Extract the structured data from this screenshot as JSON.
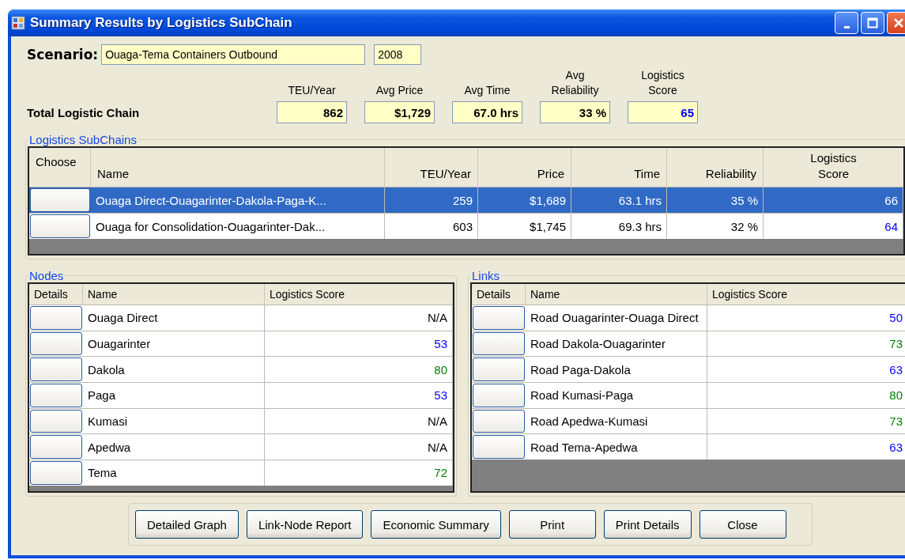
{
  "window": {
    "title": "Summary Results by Logistics SubChain"
  },
  "scenario": {
    "label": "Scenario:",
    "name": "Ouaga-Tema Containers Outbound",
    "year": "2008"
  },
  "totals": {
    "label": "Total Logistic Chain",
    "columns": [
      {
        "heading": "TEU/Year",
        "value": "862"
      },
      {
        "heading": "Avg Price",
        "value": "$1,729"
      },
      {
        "heading": "Avg Time",
        "value": "67.0 hrs"
      },
      {
        "heading": "Avg Reliability",
        "value": "33 %"
      },
      {
        "heading": "Logistics Score",
        "value": "65",
        "color": "#0000ff"
      }
    ]
  },
  "subchains": {
    "title": "Logistics SubChains",
    "columns": [
      "Choose",
      "Name",
      "TEU/Year",
      "Price",
      "Time",
      "Reliability",
      "Logistics Score"
    ],
    "rows": [
      {
        "selected": true,
        "name": "Ouaga Direct-Ouagarinter-Dakola-Paga-K...",
        "teu": "259",
        "price": "$1,689",
        "time": "63.1 hrs",
        "reliability": "35 %",
        "score": "66"
      },
      {
        "selected": false,
        "name": "Ouaga for Consolidation-Ouagarinter-Dak...",
        "teu": "603",
        "price": "$1,745",
        "time": "69.3 hrs",
        "reliability": "32 %",
        "score": "64",
        "color": "#0000ff"
      }
    ]
  },
  "nodes": {
    "title": "Nodes",
    "columns": [
      "Details",
      "Name",
      "Logistics Score"
    ],
    "rows": [
      {
        "name": "Ouaga Direct",
        "score": "N/A",
        "color": "#000000"
      },
      {
        "name": "Ouagarinter",
        "score": "53",
        "color": "#0000ff"
      },
      {
        "name": "Dakola",
        "score": "80",
        "color": "#008000"
      },
      {
        "name": "Paga",
        "score": "53",
        "color": "#0000ff"
      },
      {
        "name": "Kumasi",
        "score": "N/A",
        "color": "#000000"
      },
      {
        "name": "Apedwa",
        "score": "N/A",
        "color": "#000000"
      },
      {
        "name": "Tema",
        "score": "72",
        "color": "#008000"
      }
    ]
  },
  "links": {
    "title": "Links",
    "columns": [
      "Details",
      "Name",
      "Logistics Score"
    ],
    "rows": [
      {
        "name": "Road Ouagarinter-Ouaga Direct",
        "score": "50",
        "color": "#0000ff"
      },
      {
        "name": "Road Dakola-Ouagarinter",
        "score": "73",
        "color": "#008000"
      },
      {
        "name": "Road Paga-Dakola",
        "score": "63",
        "color": "#0000ff"
      },
      {
        "name": "Road Kumasi-Paga",
        "score": "80",
        "color": "#008000"
      },
      {
        "name": "Road Apedwa-Kumasi",
        "score": "73",
        "color": "#008000"
      },
      {
        "name": "Road Tema-Apedwa",
        "score": "63",
        "color": "#0000ff"
      }
    ]
  },
  "buttons": [
    "Detailed Graph",
    "Link-Node Report",
    "Economic Summary",
    "Print",
    "Print Details",
    "Close"
  ]
}
